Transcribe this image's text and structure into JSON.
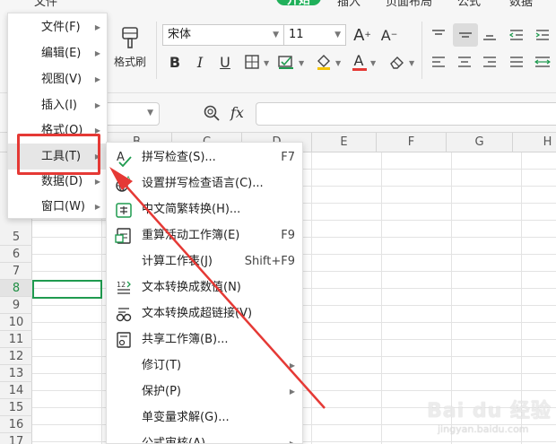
{
  "ribbon": {
    "top_tabs": [
      "文件",
      "开始",
      "插入",
      "页面布局",
      "公式",
      "数据"
    ],
    "format_painter_label": "格式刷",
    "font_name": "宋体",
    "font_size": "11"
  },
  "formula_bar": {
    "zoom_icon": "search-zoom-icon",
    "fx_label": "fx"
  },
  "grid": {
    "columns": [
      "B",
      "C",
      "D",
      "E",
      "F",
      "G",
      "H"
    ],
    "rows": [
      "5",
      "6",
      "7",
      "8",
      "9",
      "10",
      "11",
      "12",
      "13",
      "14",
      "15",
      "16",
      "17"
    ],
    "active_row": "8"
  },
  "main_menu": {
    "items": [
      {
        "label": "文件(F)"
      },
      {
        "label": "编辑(E)"
      },
      {
        "label": "视图(V)"
      },
      {
        "label": "插入(I)"
      },
      {
        "label": "格式(O)"
      },
      {
        "label": "工具(T)"
      },
      {
        "label": "数据(D)"
      },
      {
        "label": "窗口(W)"
      }
    ]
  },
  "tools_submenu": {
    "items": [
      {
        "label": "拼写检查(S)...",
        "shortcut": "F7",
        "icon": "spell-check-icon"
      },
      {
        "label": "设置拼写检查语言(C)...",
        "shortcut": "",
        "icon": "language-globe-icon"
      },
      {
        "label": "中文简繁转换(H)...",
        "shortcut": "",
        "icon": "chinese-convert-icon"
      },
      {
        "label": "重算活动工作簿(E)",
        "shortcut": "F9",
        "icon": "recalc-workbook-icon"
      },
      {
        "label": "计算工作表(J)",
        "shortcut": "Shift+F9",
        "icon": ""
      },
      {
        "label": "文本转换成数值(N)",
        "shortcut": "",
        "icon": "text-to-number-icon"
      },
      {
        "label": "文本转换成超链接(V)",
        "shortcut": "",
        "icon": "text-to-link-icon"
      },
      {
        "label": "共享工作簿(B)...",
        "shortcut": "",
        "icon": "share-workbook-icon"
      },
      {
        "label": "修订(T)",
        "shortcut": "",
        "icon": ""
      },
      {
        "label": "保护(P)",
        "shortcut": "",
        "icon": ""
      },
      {
        "label": "单变量求解(G)...",
        "shortcut": "",
        "icon": ""
      },
      {
        "label": "公式审核(A)",
        "shortcut": "",
        "icon": ""
      }
    ]
  },
  "watermark": {
    "brand": "Bai du 经验",
    "url": "jingyan.baidu.com"
  },
  "colors": {
    "accent_green": "#20b05a",
    "annotation_red": "#e53935",
    "selection_green": "#1f9b4f"
  }
}
